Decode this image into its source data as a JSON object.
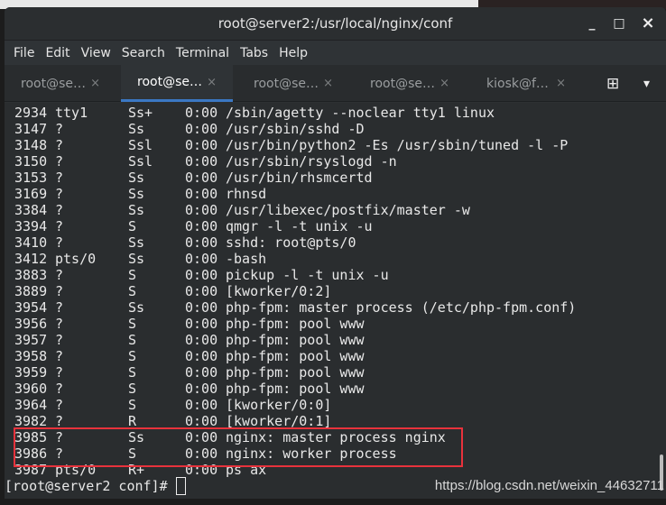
{
  "window": {
    "title": "root@server2:/usr/local/nginx/conf",
    "minimize": "_",
    "maximize": "□",
    "close": "×"
  },
  "menu": [
    "File",
    "Edit",
    "View",
    "Search",
    "Terminal",
    "Tabs",
    "Help"
  ],
  "tabs": [
    {
      "label": "root@se…",
      "active": false
    },
    {
      "label": "root@se…",
      "active": true
    },
    {
      "label": "root@se…",
      "active": false
    },
    {
      "label": "root@se…",
      "active": false
    },
    {
      "label": "kiosk@f…",
      "active": false
    }
  ],
  "tab_close": "×",
  "new_tab_icon": "⊞",
  "tab_menu_icon": "▾",
  "processes": [
    [
      "2934",
      "tty1",
      "Ss+",
      "0:00",
      "/sbin/agetty --noclear tty1 linux"
    ],
    [
      "3147",
      "?",
      "Ss",
      "0:00",
      "/usr/sbin/sshd -D"
    ],
    [
      "3148",
      "?",
      "Ssl",
      "0:00",
      "/usr/bin/python2 -Es /usr/sbin/tuned -l -P"
    ],
    [
      "3150",
      "?",
      "Ssl",
      "0:00",
      "/usr/sbin/rsyslogd -n"
    ],
    [
      "3153",
      "?",
      "Ss",
      "0:00",
      "/usr/bin/rhsmcertd"
    ],
    [
      "3169",
      "?",
      "Ss",
      "0:00",
      "rhnsd"
    ],
    [
      "3384",
      "?",
      "Ss",
      "0:00",
      "/usr/libexec/postfix/master -w"
    ],
    [
      "3394",
      "?",
      "S",
      "0:00",
      "qmgr -l -t unix -u"
    ],
    [
      "3410",
      "?",
      "Ss",
      "0:00",
      "sshd: root@pts/0"
    ],
    [
      "3412",
      "pts/0",
      "Ss",
      "0:00",
      "-bash"
    ],
    [
      "3883",
      "?",
      "S",
      "0:00",
      "pickup -l -t unix -u"
    ],
    [
      "3889",
      "?",
      "S",
      "0:00",
      "[kworker/0:2]"
    ],
    [
      "3954",
      "?",
      "Ss",
      "0:00",
      "php-fpm: master process (/etc/php-fpm.conf)"
    ],
    [
      "3956",
      "?",
      "S",
      "0:00",
      "php-fpm: pool www"
    ],
    [
      "3957",
      "?",
      "S",
      "0:00",
      "php-fpm: pool www"
    ],
    [
      "3958",
      "?",
      "S",
      "0:00",
      "php-fpm: pool www"
    ],
    [
      "3959",
      "?",
      "S",
      "0:00",
      "php-fpm: pool www"
    ],
    [
      "3960",
      "?",
      "S",
      "0:00",
      "php-fpm: pool www"
    ],
    [
      "3964",
      "?",
      "S",
      "0:00",
      "[kworker/0:0]"
    ],
    [
      "3982",
      "?",
      "R",
      "0:00",
      "[kworker/0:1]"
    ],
    [
      "3985",
      "?",
      "Ss",
      "0:00",
      "nginx: master process nginx"
    ],
    [
      "3986",
      "?",
      "S",
      "0:00",
      "nginx: worker process"
    ],
    [
      "3987",
      "pts/0",
      "R+",
      "0:00",
      "ps ax"
    ]
  ],
  "prompt": "[root@server2 conf]#",
  "watermark": "https://blog.csdn.net/weixin_44632711",
  "colors": {
    "highlight": "#e8323c",
    "active_tab_underline": "#3b78c4",
    "terminal_bg": "#2a2d2f"
  }
}
